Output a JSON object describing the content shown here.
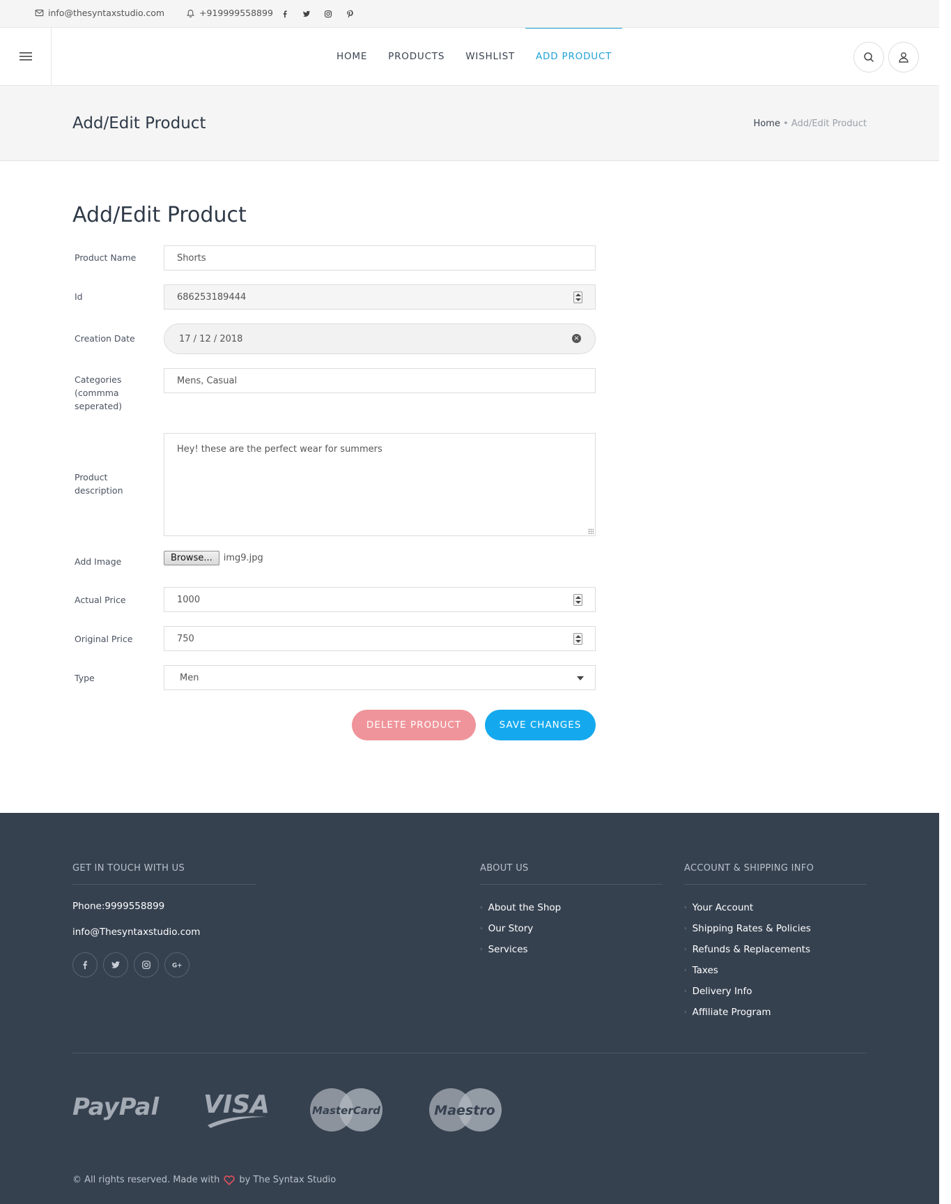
{
  "topbar": {
    "email": "info@thesyntaxstudio.com",
    "phone": "+919999558899",
    "social_icons": [
      "facebook-icon",
      "twitter-icon",
      "instagram-icon",
      "pinterest-icon"
    ]
  },
  "header": {
    "nav": [
      {
        "label": "HOME",
        "active": false
      },
      {
        "label": "PRODUCTS",
        "active": false
      },
      {
        "label": "WISHLIST",
        "active": false
      },
      {
        "label": "ADD PRODUCT",
        "active": true
      }
    ],
    "accent_color": "#1fa2d6"
  },
  "banner": {
    "title": "Add/Edit Product",
    "breadcrumb_home": "Home",
    "breadcrumb_sep": "•",
    "breadcrumb_current": "Add/Edit Product"
  },
  "form": {
    "title": "Add/Edit Product",
    "product_name": {
      "label": "Product Name",
      "value": "Shorts"
    },
    "id": {
      "label": "Id",
      "value": "686253189444"
    },
    "creation_date": {
      "label": "Creation Date",
      "value": "17 / 12 / 2018"
    },
    "categories": {
      "label": "Categories (commma seperated)",
      "value": "Mens, Casual"
    },
    "description": {
      "label": "Product description",
      "value": "Hey! these are the perfect wear for summers"
    },
    "image": {
      "label": "Add Image",
      "button": "Browse...",
      "file_name": "img9.jpg"
    },
    "actual_price": {
      "label": "Actual Price",
      "value": "1000"
    },
    "original_price": {
      "label": "Original Price",
      "value": "750"
    },
    "type": {
      "label": "Type",
      "value": "Men"
    },
    "delete_label": "DELETE PRODUCT",
    "save_label": "SAVE CHANGES",
    "delete_color": "#ef949a",
    "save_color": "#14a9ee"
  },
  "footer": {
    "contact_title": "GET IN TOUCH WITH US",
    "phone": "Phone:9999558899",
    "email": "info@Thesyntaxstudio.com",
    "social_icons": [
      "facebook-icon",
      "twitter-icon",
      "instagram-icon",
      "google-plus-icon"
    ],
    "about_title": "ABOUT US",
    "about_links": [
      "About the Shop",
      "Our Story",
      "Services"
    ],
    "account_title": "ACCOUNT & SHIPPING INFO",
    "account_links": [
      "Your Account",
      "Shipping Rates & Policies",
      "Refunds & Replacements",
      "Taxes",
      "Delivery Info",
      "Affiliate Program"
    ],
    "payment_logos": [
      "PayPal",
      "VISA",
      "MasterCard",
      "Maestro"
    ],
    "copyright_prefix": "© All rights reserved. Made with",
    "copyright_suffix": "by The Syntax Studio",
    "background_color": "#364150"
  }
}
